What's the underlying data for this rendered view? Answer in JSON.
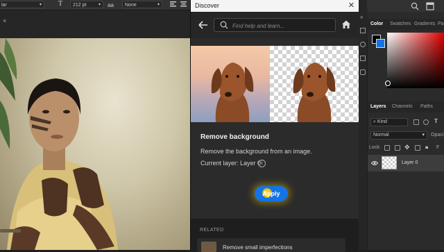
{
  "options_bar": {
    "font_style_value": "lar",
    "font_size_value": "212 pt",
    "antialias_value": "None"
  },
  "discover": {
    "title": "Discover",
    "search_placeholder": "Find help and learn...",
    "feature_title": "Remove background",
    "feature_description": "Remove the background from an image.",
    "current_layer_label": "Current layer: Layer 0",
    "apply_label": "Apply",
    "related_heading": "RELATED",
    "related_item_label": "Remove small imperfections"
  },
  "right_panel": {
    "color_tabs": [
      "Color",
      "Swatches",
      "Gradients",
      "Pa"
    ],
    "layers_tabs": [
      "Layers",
      "Channels",
      "Paths"
    ],
    "kind_value": "Kind",
    "blend_mode_value": "Normal",
    "opacity_label": "Opaci",
    "lock_label": "Lock:",
    "fill_label": "F",
    "layer_name": "Layer 0",
    "foreground_color": "#000000",
    "background_color": "#1473e6"
  },
  "colors": {
    "accent": "#1473e6",
    "panel_bg": "#2b2b2b",
    "app_bg": "#1e1e1e"
  }
}
